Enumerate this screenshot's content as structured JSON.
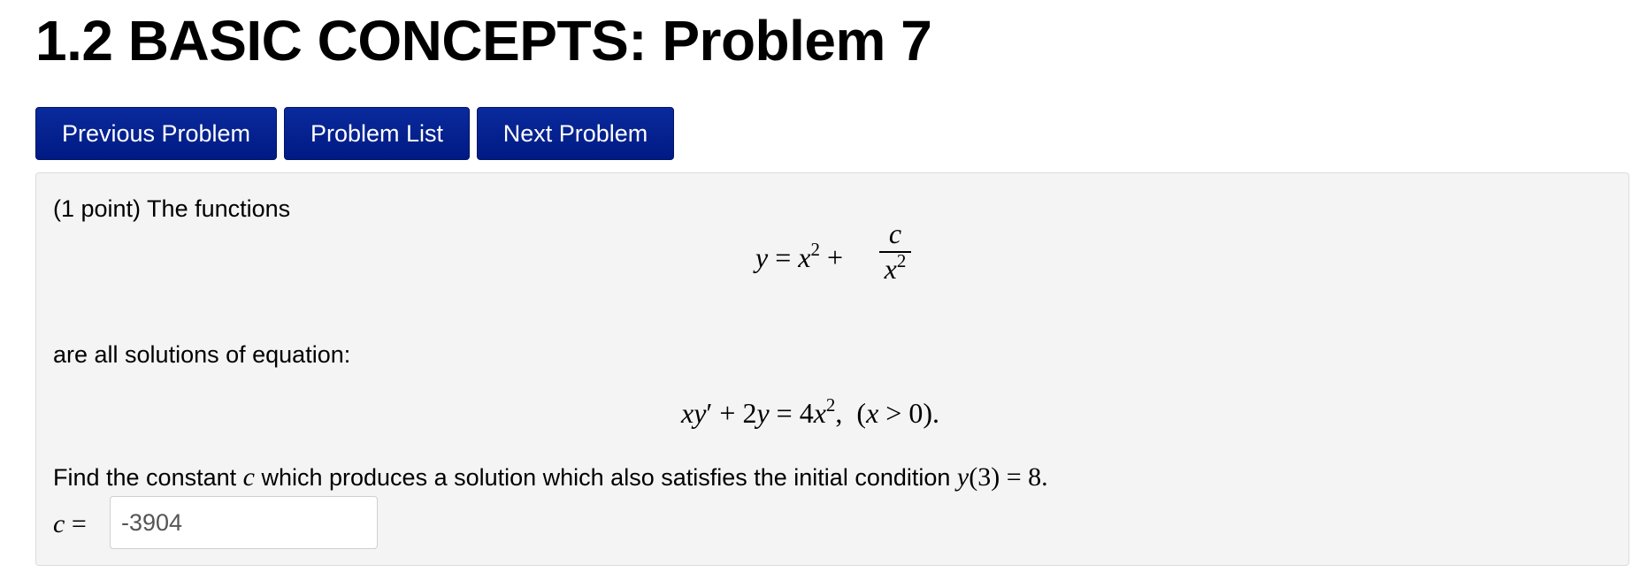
{
  "page": {
    "title": "1.2 BASIC CONCEPTS: Problem 7"
  },
  "nav": {
    "previous_label": "Previous Problem",
    "list_label": "Problem List",
    "next_label": "Next Problem"
  },
  "problem": {
    "intro": "(1 point) The functions",
    "equation1": {
      "lhs_var": "y",
      "lhs_rest": " = ",
      "x": "x",
      "exp": "2",
      "plus": " +",
      "num": "c",
      "den_x": "x",
      "den_exp": "2"
    },
    "middle_text": "are all solutions of equation:",
    "equation2": {
      "part1": "xy",
      "prime": "′",
      "part2": " + 2",
      "y": "y",
      "part3": " = 4",
      "x": "x",
      "exp": "2",
      "part4": ",  (",
      "x2": "x",
      "part5": " > 0)."
    },
    "find_text_before": "Find the constant ",
    "find_var": "c",
    "find_text_after": " which produces a solution which also satisfies the initial condition ",
    "init_func": "y",
    "init_rest": "(3) = 8.",
    "answer_label_var": "c",
    "answer_label_eq": " =",
    "answer_value": "-3904"
  },
  "colors": {
    "button_bg": "#00208f",
    "button_text": "#ffffff",
    "panel_bg": "#f4f4f4",
    "panel_border": "#dcdcdc"
  }
}
